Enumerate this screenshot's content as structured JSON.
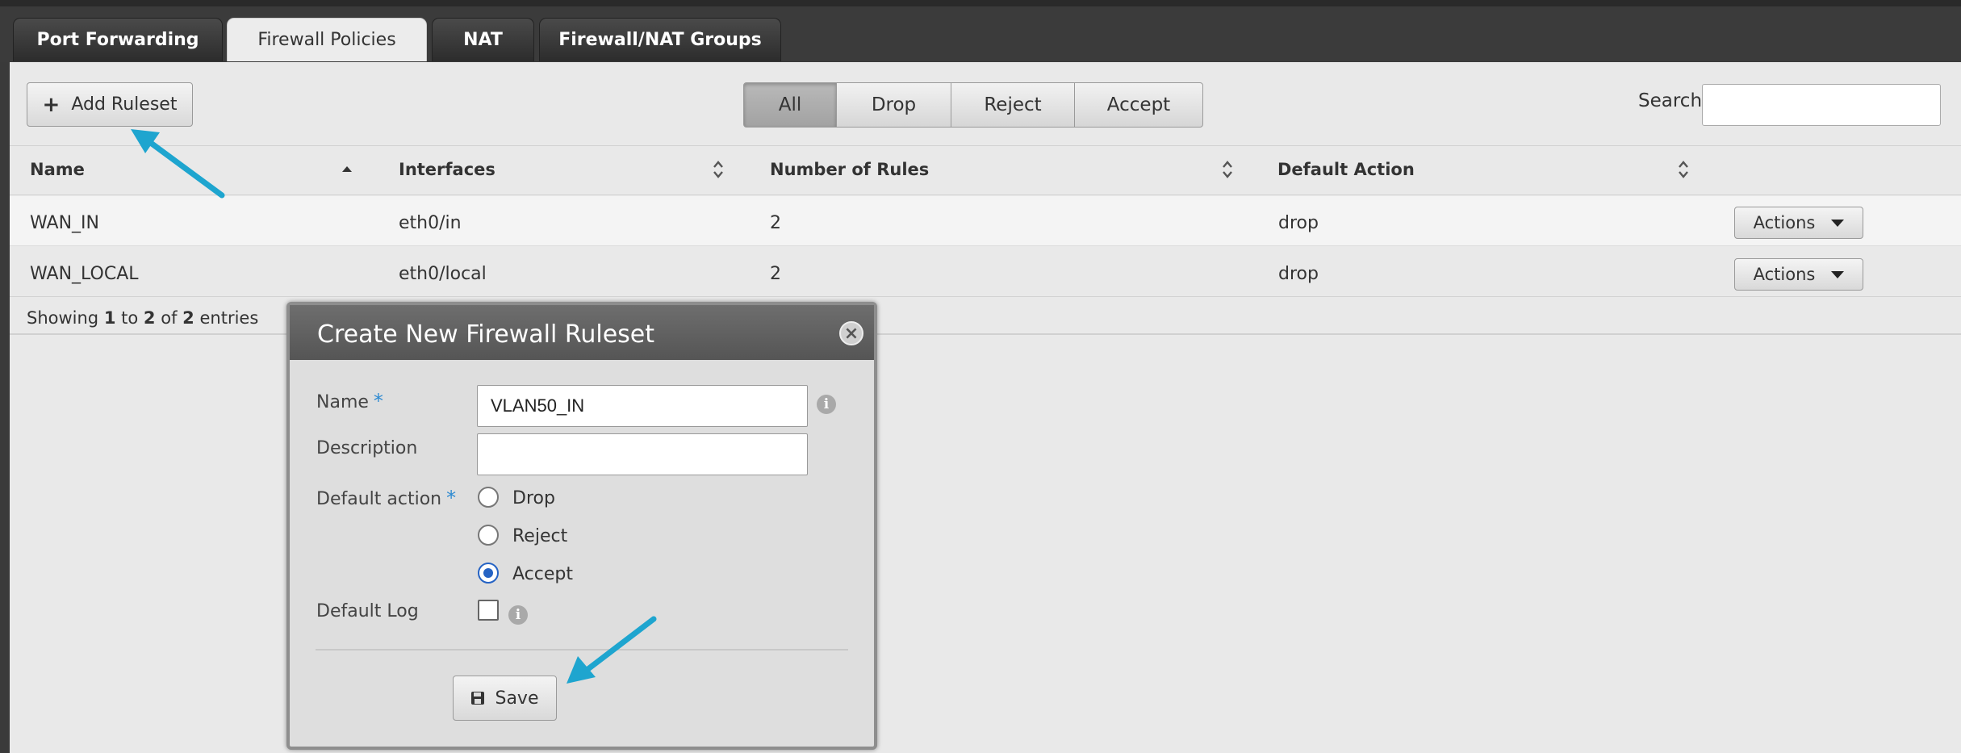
{
  "tabs": [
    {
      "label": "Port Forwarding",
      "active": false
    },
    {
      "label": "Firewall Policies",
      "active": true
    },
    {
      "label": "NAT",
      "active": false
    },
    {
      "label": "Firewall/NAT Groups",
      "active": false
    }
  ],
  "toolbar": {
    "add_ruleset_label": "Add Ruleset",
    "filters": [
      "All",
      "Drop",
      "Reject",
      "Accept"
    ],
    "active_filter": "All",
    "search_label": "Search",
    "search_value": ""
  },
  "table": {
    "columns": [
      "Name",
      "Interfaces",
      "Number of Rules",
      "Default Action"
    ],
    "rows": [
      {
        "name": "WAN_IN",
        "interfaces": "eth0/in",
        "rules": "2",
        "action": "drop",
        "actions_label": "Actions"
      },
      {
        "name": "WAN_LOCAL",
        "interfaces": "eth0/local",
        "rules": "2",
        "action": "drop",
        "actions_label": "Actions"
      }
    ],
    "footer": {
      "prefix": "Showing",
      "from": "1",
      "to_word": "to",
      "to": "2",
      "of_word": "of",
      "total": "2",
      "suffix": "entries"
    }
  },
  "dialog": {
    "title": "Create New Firewall Ruleset",
    "name_label": "Name",
    "name_value": "VLAN50_IN",
    "description_label": "Description",
    "description_value": "",
    "default_action_label": "Default action",
    "options": [
      "Drop",
      "Reject",
      "Accept"
    ],
    "selected_option": "Accept",
    "default_log_label": "Default Log",
    "default_log_checked": false,
    "required_mark": "*",
    "save_label": "Save"
  },
  "colors": {
    "accent": "#2563c4",
    "annotation_arrow": "#1ea5cf"
  }
}
